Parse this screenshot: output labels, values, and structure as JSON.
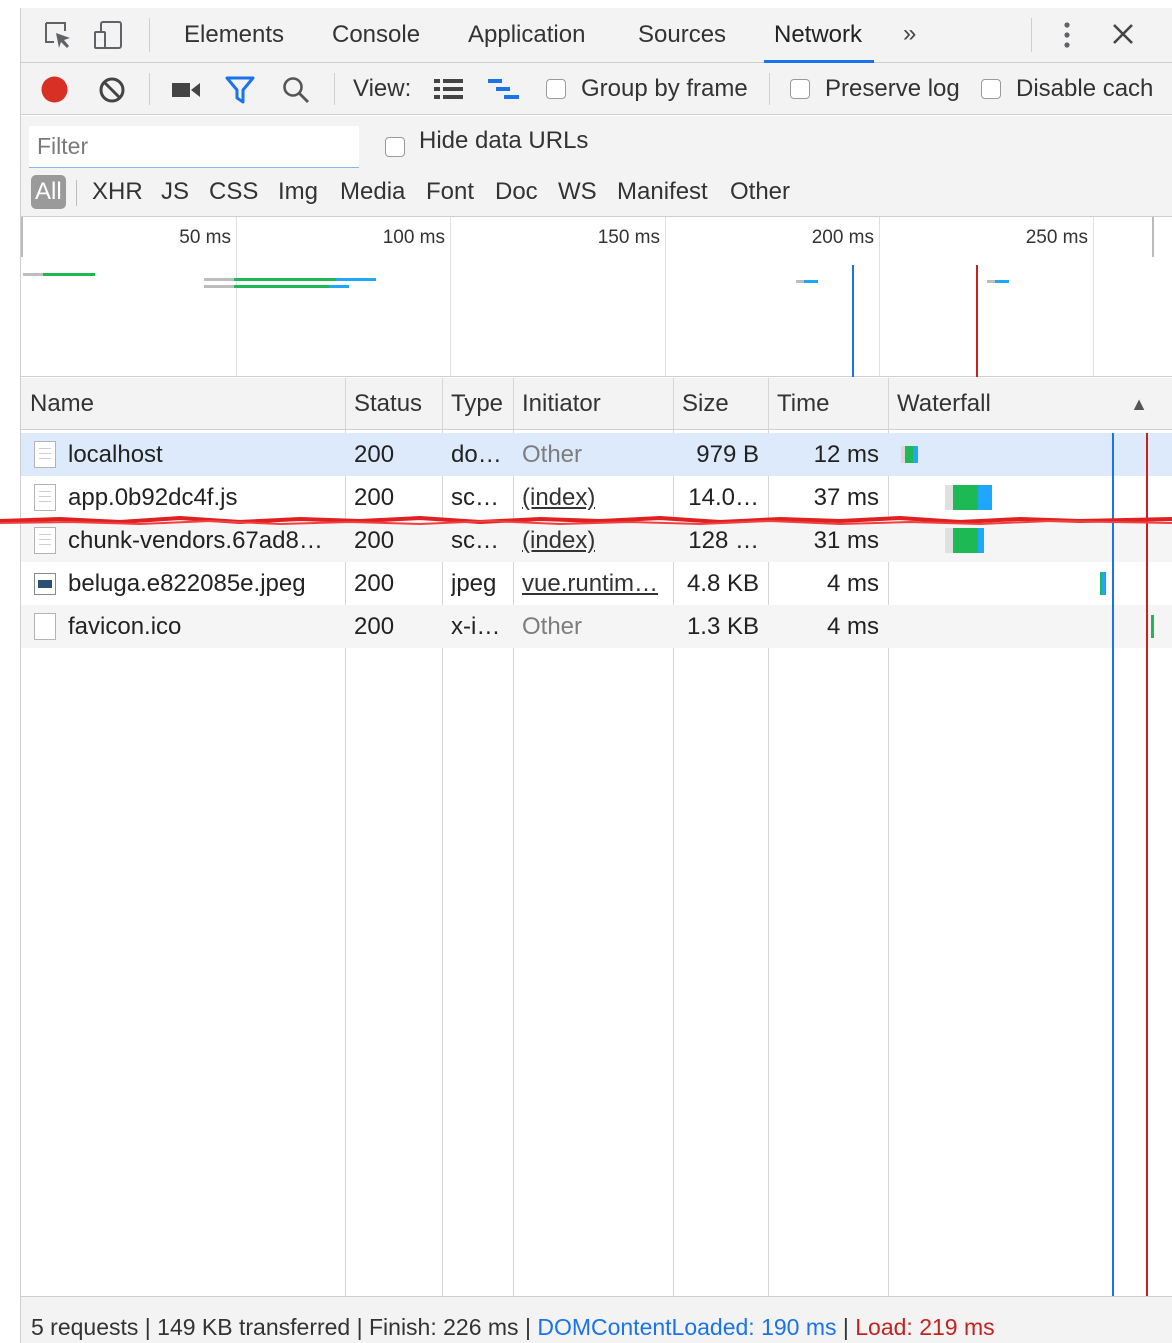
{
  "tabs": [
    {
      "label": "Elements",
      "active": false
    },
    {
      "label": "Console",
      "active": false
    },
    {
      "label": "Application",
      "active": false
    },
    {
      "label": "Sources",
      "active": false
    },
    {
      "label": "Network",
      "active": true
    }
  ],
  "tab_more": "»",
  "toolbar": {
    "view_label": "View:",
    "group_by_frame": "Group by frame",
    "preserve_log": "Preserve log",
    "disable_cache": "Disable cach"
  },
  "filter": {
    "placeholder": "Filter",
    "hide_data_urls": "Hide data URLs",
    "types": [
      "All",
      "XHR",
      "JS",
      "CSS",
      "Img",
      "Media",
      "Font",
      "Doc",
      "WS",
      "Manifest",
      "Other"
    ]
  },
  "overview": {
    "ticks": [
      "50 ms",
      "100 ms",
      "150 ms",
      "200 ms",
      "250 ms"
    ]
  },
  "table": {
    "headers": {
      "name": "Name",
      "status": "Status",
      "type": "Type",
      "initiator": "Initiator",
      "size": "Size",
      "time": "Time",
      "waterfall": "Waterfall"
    },
    "rows": [
      {
        "name": "localhost",
        "status": "200",
        "type": "do…",
        "initiator": "Other",
        "size": "979 B",
        "time": "12 ms"
      },
      {
        "name": "app.0b92dc4f.js",
        "status": "200",
        "type": "sc…",
        "initiator": "(index)",
        "size": "14.0…",
        "time": "37 ms"
      },
      {
        "name": "chunk-vendors.67ad8…",
        "status": "200",
        "type": "sc…",
        "initiator": "(index)",
        "size": "128 …",
        "time": "31 ms"
      },
      {
        "name": "beluga.e822085e.jpeg",
        "status": "200",
        "type": "jpeg",
        "initiator": "vue.runtim…",
        "size": "4.8 KB",
        "time": "4 ms"
      },
      {
        "name": "favicon.ico",
        "status": "200",
        "type": "x-i…",
        "initiator": "Other",
        "size": "1.3 KB",
        "time": "4 ms"
      }
    ]
  },
  "status": {
    "requests": "5 requests",
    "transferred": "149 KB transferred",
    "finish": "Finish: 226 ms",
    "dom_content_loaded": "DOMContentLoaded: 190 ms",
    "load": "Load: 219 ms",
    "separator": "|"
  },
  "colors": {
    "accent": "#1a73e8",
    "record": "#d93025",
    "download": "#1ea7fd",
    "waiting": "#1db954",
    "load_line": "#c5221f",
    "dcl_line": "#1a73e8"
  }
}
